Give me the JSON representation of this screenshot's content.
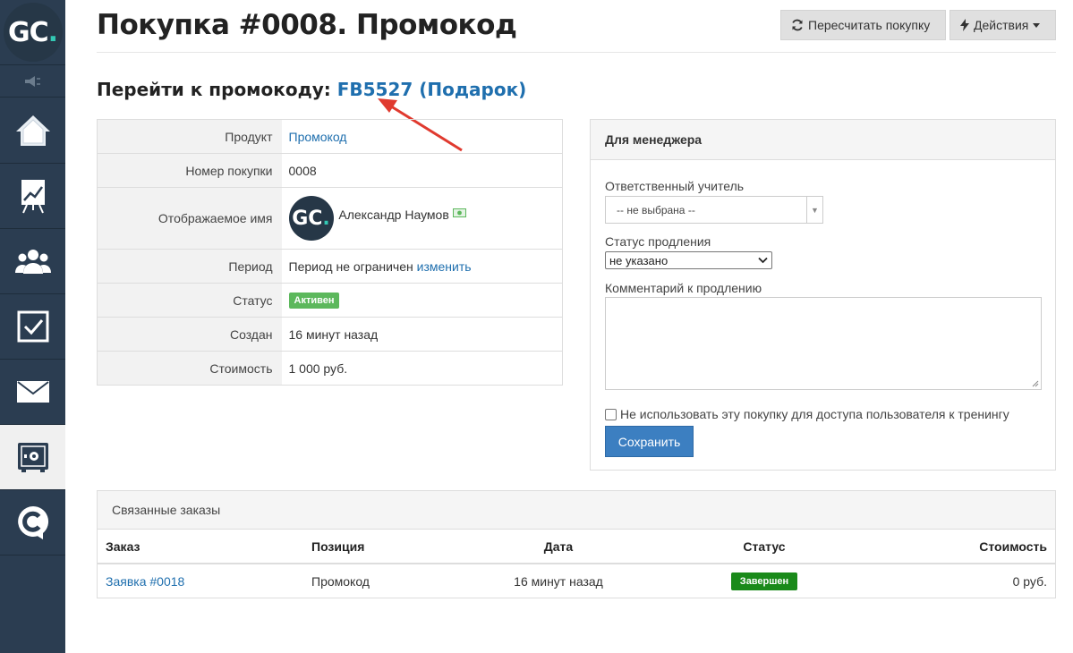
{
  "sidebar": {
    "logo_text": "GC",
    "logo_dot": ".",
    "items": [
      {
        "name": "home",
        "icon": "home-icon"
      },
      {
        "name": "analytics",
        "icon": "chart-board-icon"
      },
      {
        "name": "users",
        "icon": "users-icon"
      },
      {
        "name": "tasks",
        "icon": "checkbox-icon"
      },
      {
        "name": "messages",
        "icon": "envelope-icon"
      },
      {
        "name": "sales",
        "icon": "safe-icon",
        "active": true
      },
      {
        "name": "chat",
        "icon": "chat-c-icon"
      }
    ]
  },
  "header": {
    "title": "Покупка #0008. Промокод",
    "recalc_button": "Пересчитать покупку",
    "actions_button": "Действия"
  },
  "promo": {
    "heading": "Перейти к промокоду: ",
    "code_link": "FB5527 (Подарок)"
  },
  "info": {
    "rows": [
      {
        "label": "Продукт",
        "value": "Промокод"
      },
      {
        "label": "Номер покупки",
        "value": "0008"
      },
      {
        "label": "Отображаемое имя",
        "value": "Александр Наумов"
      },
      {
        "label": "Период",
        "value": "Период не ограничен",
        "link": "изменить"
      },
      {
        "label": "Статус",
        "value": "Активен"
      },
      {
        "label": "Создан",
        "value": "16 минут назад"
      },
      {
        "label": "Стоимость",
        "value": "1 000 руб."
      }
    ],
    "avatar_text": "GC",
    "avatar_dot": "."
  },
  "manager": {
    "title": "Для менеджера",
    "teacher_label": "Ответственный учитель",
    "teacher_value": "-- не выбрана --",
    "renewal_status_label": "Статус продления",
    "renewal_status_value": "не указано",
    "comment_label": "Комментарий к продлению",
    "comment_value": "",
    "checkbox_label": "Не использовать эту покупку для доступа пользователя к тренингу",
    "checkbox_checked": false,
    "save_button": "Сохранить"
  },
  "orders": {
    "title": "Связанные заказы",
    "columns": [
      "Заказ",
      "Позиция",
      "Дата",
      "Статус",
      "Стоимость"
    ],
    "rows": [
      {
        "order": "Заявка #0018",
        "position": "Промокод",
        "date": "16 минут назад",
        "status": "Завершен",
        "price": "0 руб."
      }
    ]
  },
  "colors": {
    "sidebar_bg": "#2b3d51",
    "link": "#1f6fae",
    "badge_active": "#5cb85c",
    "badge_done": "#1a8a1a",
    "save_button": "#3c7fc1",
    "annotation_arrow": "#e03a2f"
  }
}
